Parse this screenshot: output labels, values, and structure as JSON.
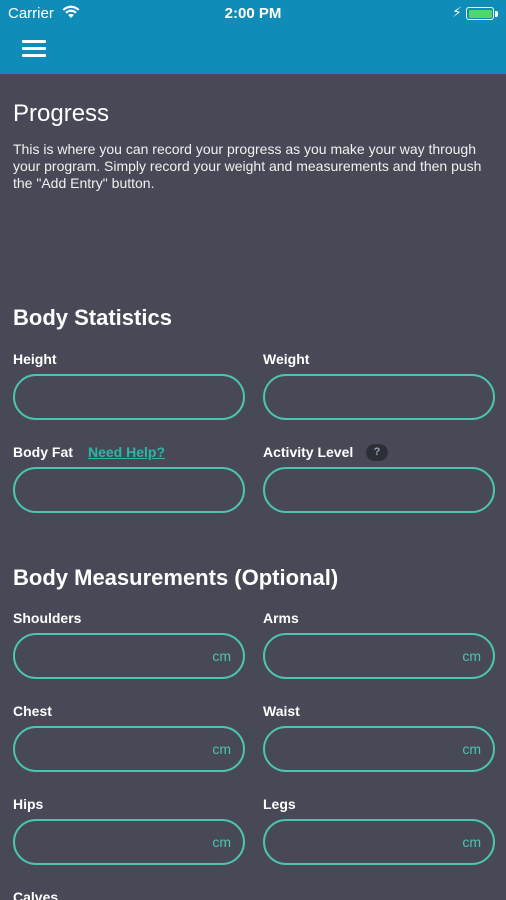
{
  "status_bar": {
    "carrier": "Carrier",
    "time": "2:00 PM",
    "battery_level": 1.0
  },
  "header": {
    "menu_icon": "hamburger-menu-icon",
    "color": "#0f8cb8"
  },
  "page": {
    "title": "Progress",
    "intro": "This is where you can record your progress as you make your way through your program. Simply record your weight and measurements and then push the \"Add Entry\" button."
  },
  "body_statistics": {
    "title": "Body Statistics",
    "height_label": "Height",
    "weight_label": "Weight",
    "body_fat_label": "Body Fat",
    "need_help": "Need Help?",
    "activity_label": "Activity Level",
    "activity_help": "?"
  },
  "body_measurements": {
    "title": "Body Measurements (Optional)",
    "unit": "cm",
    "shoulders_label": "Shoulders",
    "arms_label": "Arms",
    "chest_label": "Chest",
    "waist_label": "Waist",
    "hips_label": "Hips",
    "legs_label": "Legs",
    "calves_label": "Calves"
  },
  "colors": {
    "background": "#474a56",
    "accent": "#4ec3b0",
    "link": "#2bb6a8"
  }
}
